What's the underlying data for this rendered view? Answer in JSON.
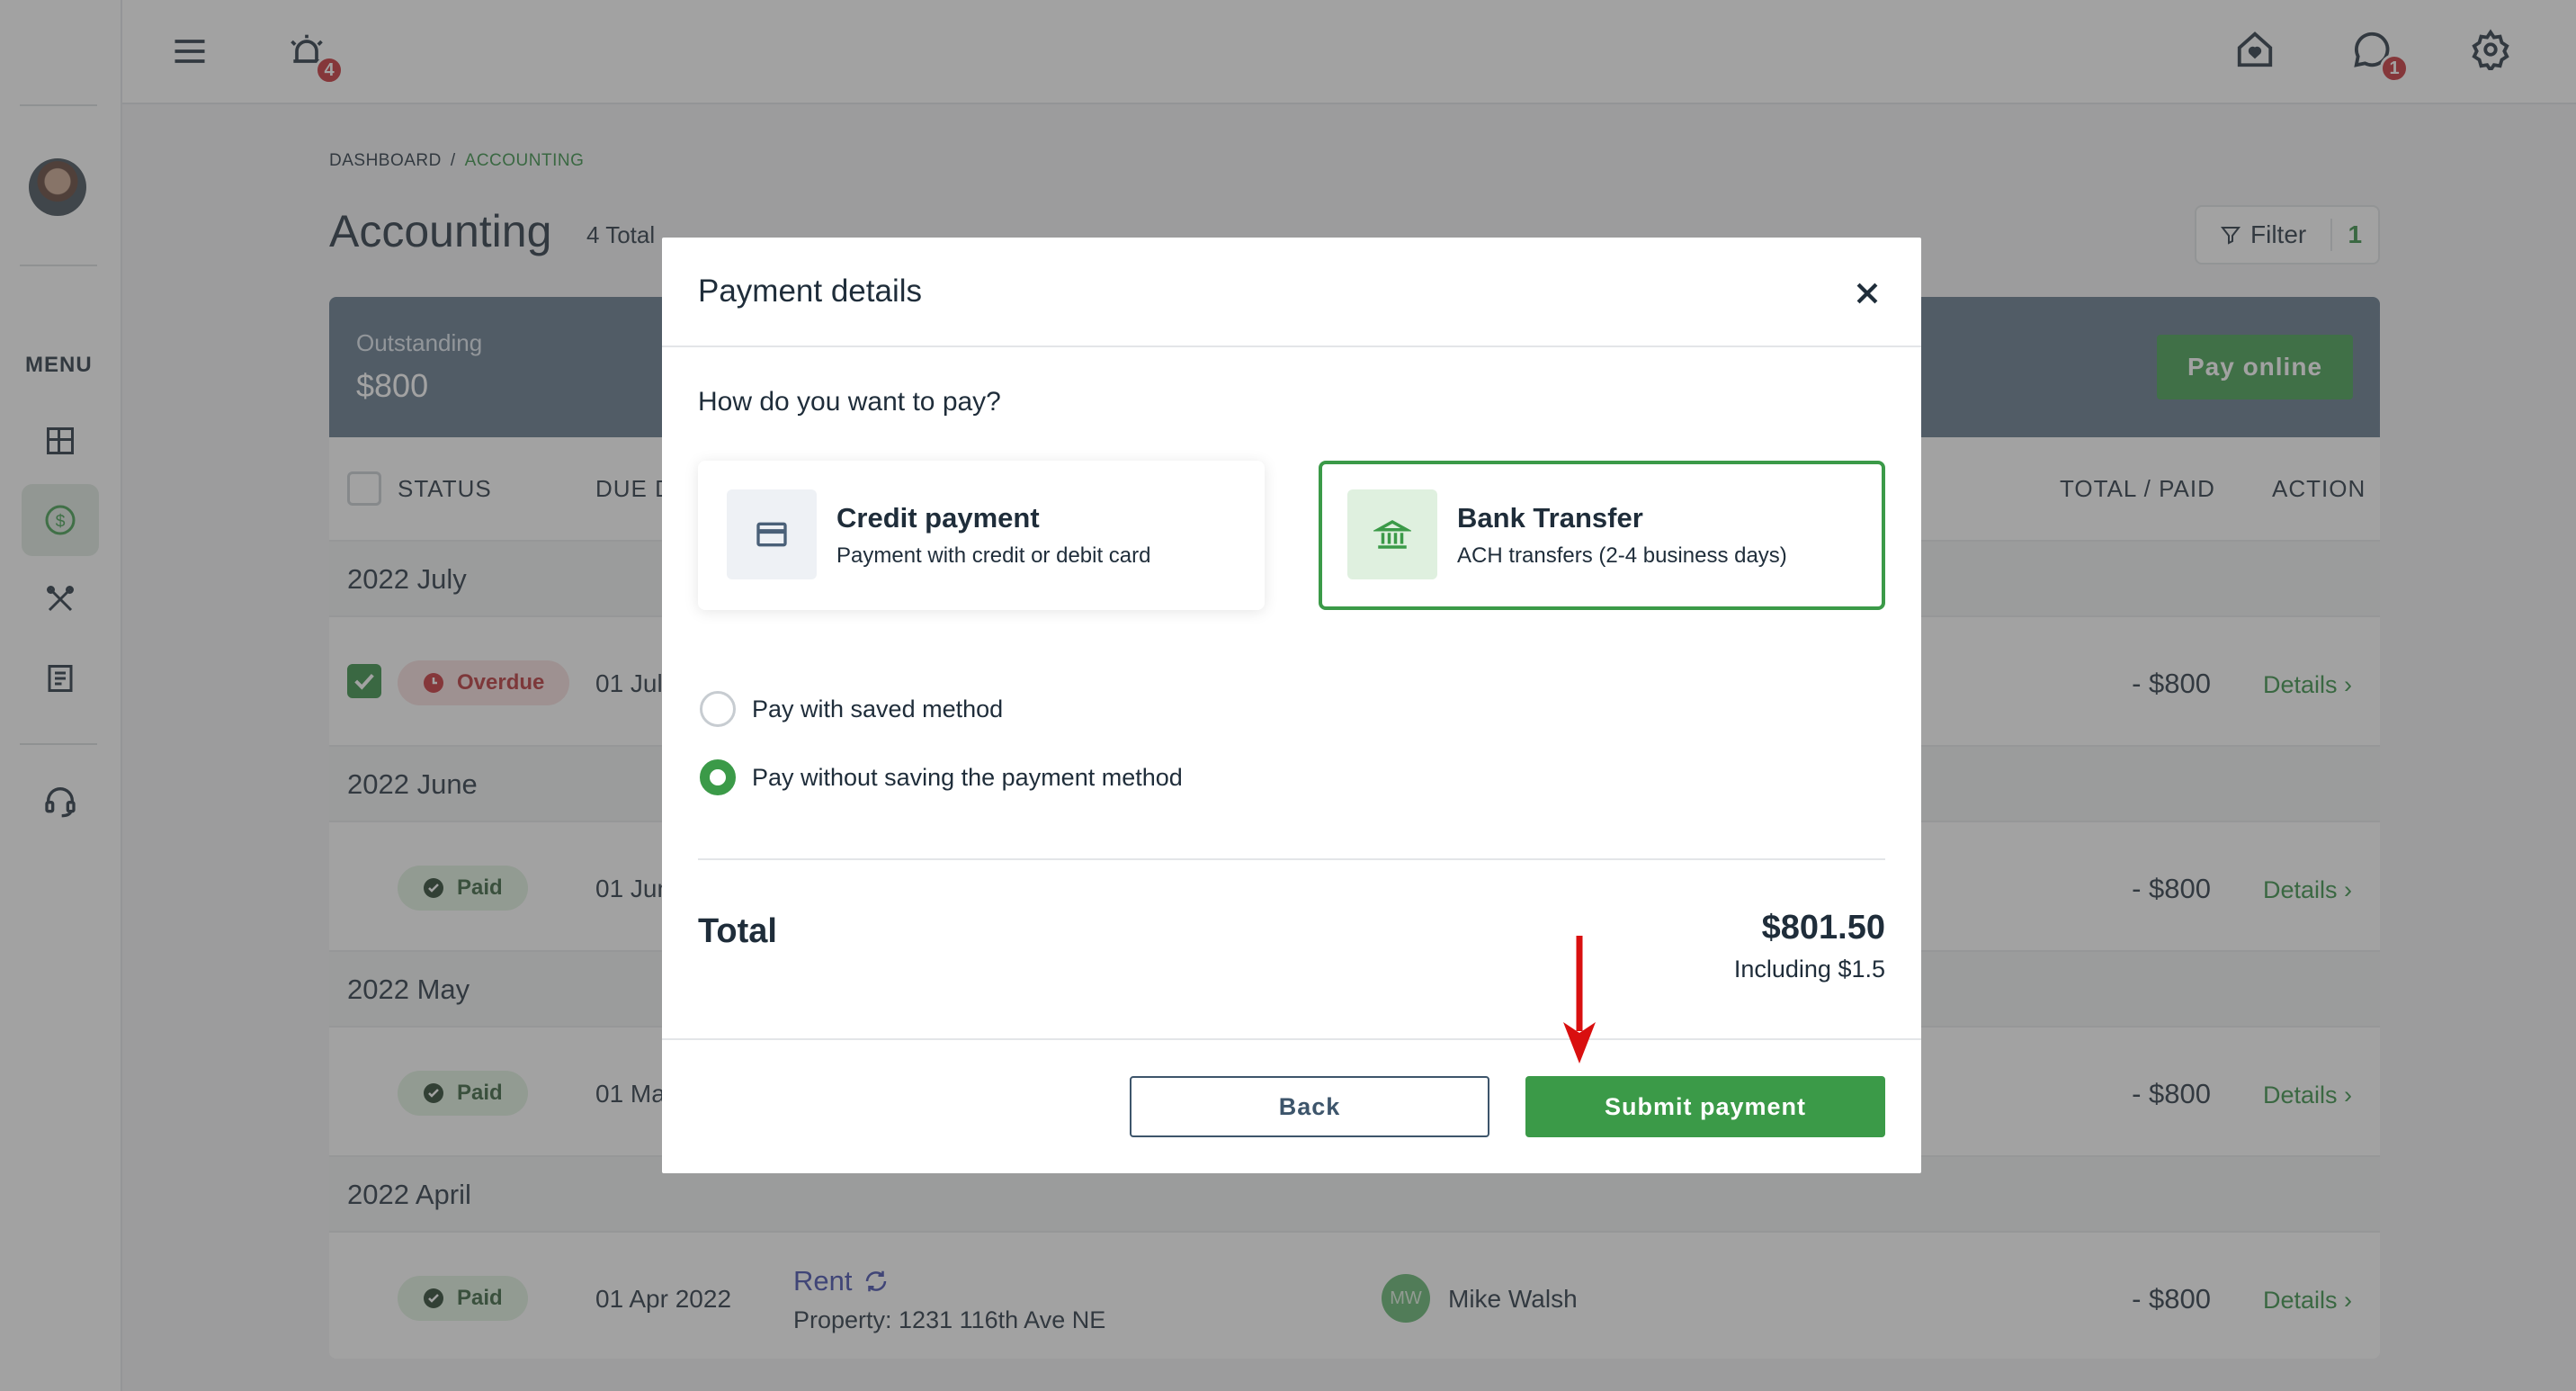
{
  "topbar": {
    "alarm_badge": "4",
    "chat_badge": "1"
  },
  "sidebar": {
    "menu_label": "MENU"
  },
  "breadcrumb": {
    "root": "DASHBOARD",
    "separator": "/",
    "current": "ACCOUNTING"
  },
  "page": {
    "title": "Accounting",
    "count": "4 Total"
  },
  "filter": {
    "label": "Filter",
    "count": "1"
  },
  "summary": {
    "outstanding_label": "Outstanding",
    "outstanding_value": "$800",
    "pay_online": "Pay online"
  },
  "table": {
    "headers": {
      "status": "STATUS",
      "due": "DUE D",
      "total_paid": "TOTAL / PAID",
      "action": "ACTION"
    },
    "groups": [
      {
        "label": "2022 July",
        "status": "Overdue",
        "due": "01 Jul",
        "amount": "- $800",
        "action": "Details ›"
      },
      {
        "label": "2022 June",
        "status": "Paid",
        "due": "01 Jun",
        "amount": "- $800",
        "action": "Details ›"
      },
      {
        "label": "2022 May",
        "status": "Paid",
        "due": "01 Ma",
        "amount": "- $800",
        "action": "Details ›"
      },
      {
        "label": "2022 April",
        "status": "Paid",
        "due": "01 Apr 2022",
        "amount": "- $800",
        "action": "Details ›",
        "title": "Rent",
        "property": "Property: 1231 116th Ave NE",
        "tenant_initials": "MW",
        "tenant": "Mike Walsh"
      }
    ]
  },
  "modal": {
    "title": "Payment details",
    "question": "How do you want to pay?",
    "options": [
      {
        "title": "Credit payment",
        "subtitle": "Payment with credit or debit card",
        "icon": "credit-card-icon",
        "selected": false
      },
      {
        "title": "Bank Transfer",
        "subtitle": "ACH transfers (2-4 business days)",
        "icon": "bank-icon",
        "selected": true
      }
    ],
    "radios": [
      {
        "label": "Pay with saved method",
        "checked": false
      },
      {
        "label": "Pay without saving the payment method",
        "checked": true
      }
    ],
    "total_label": "Total",
    "total_value": "$801.50",
    "total_note": "Including $1.5",
    "back_label": "Back",
    "submit_label": "Submit payment"
  },
  "colors": {
    "accent": "#3b9a48",
    "header_band": "#5c7287",
    "danger": "#c5292f",
    "annotation_arrow": "#d90f0f"
  }
}
